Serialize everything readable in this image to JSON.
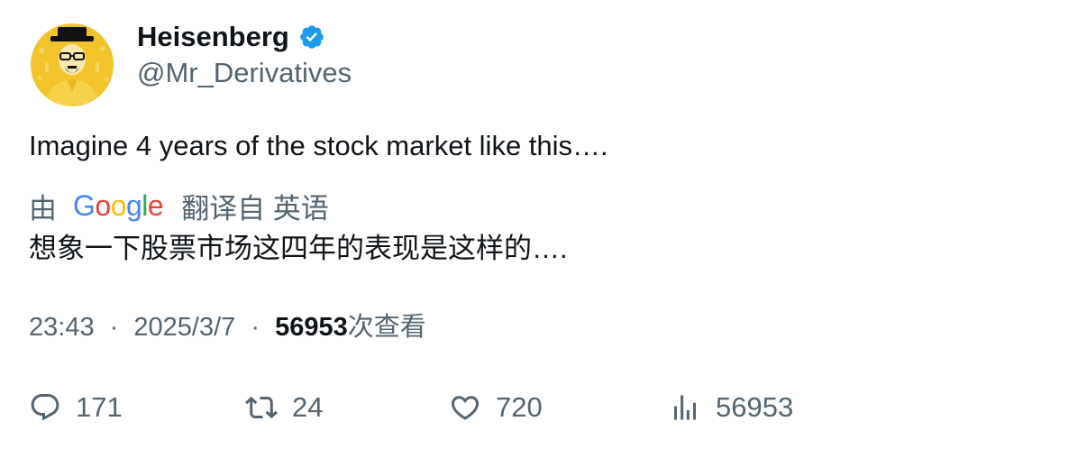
{
  "author": {
    "display_name": "Heisenberg",
    "handle": "@Mr_Derivatives",
    "verified": true,
    "avatar_bg": "#f2c32b"
  },
  "tweet": {
    "text": "Imagine 4 years of the stock market like this….",
    "translation": {
      "prefix": "由",
      "provider_letters": [
        "G",
        "o",
        "o",
        "g",
        "l",
        "e"
      ],
      "provider_colors": [
        "#4285F4",
        "#EA4335",
        "#FBBC05",
        "#4285F4",
        "#34A853",
        "#EA4335"
      ],
      "suffix": "翻译自 英语",
      "text": "想象一下股票市场这四年的表现是这样的…."
    }
  },
  "meta": {
    "time": "23:43",
    "separator": "·",
    "date": "2025/3/7",
    "views_count": "56953",
    "views_label": "次查看"
  },
  "actions": {
    "reply": {
      "icon": "reply-icon",
      "count": "171"
    },
    "retweet": {
      "icon": "retweet-icon",
      "count": "24"
    },
    "like": {
      "icon": "heart-icon",
      "count": "720"
    },
    "views": {
      "icon": "analytics-icon",
      "count": "56953"
    }
  },
  "colors": {
    "text_primary": "#0f1419",
    "text_secondary": "#536471",
    "verified_blue": "#1d9bf0"
  }
}
